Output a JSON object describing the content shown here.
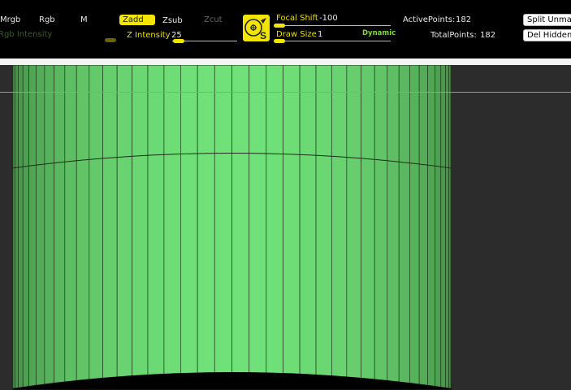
{
  "toolbar": {
    "mrgb": "Mrgb",
    "rgb": "Rgb",
    "m": "M",
    "zadd": "Zadd",
    "zsub": "Zsub",
    "zcut": "Zcut",
    "rgb_intensity_label": "Rgb Intensity",
    "z_intensity_label": "Z Intensity",
    "z_intensity_value": "25",
    "focal_shift_label": "Focal Shift",
    "focal_shift_value": "-100",
    "draw_size_label": "Draw Size",
    "draw_size_value": "1",
    "dynamic_label": "Dynamic",
    "active_points_label": "ActivePoints:",
    "active_points_value": "182",
    "total_points_label": "TotalPoints:",
    "total_points_value": "182",
    "split_unmasked_label": "Split Unmas",
    "del_hidden_label": "Del Hidden",
    "brush_icon": "standard-brush-icon",
    "brush_icon_letter": "S"
  },
  "colors": {
    "accent_yellow": "#f2e600",
    "mesh_green": "#6fdc76",
    "viewport_bg": "#2c2c2c"
  },
  "viewport": {
    "mesh": "cylinder-mesh"
  }
}
